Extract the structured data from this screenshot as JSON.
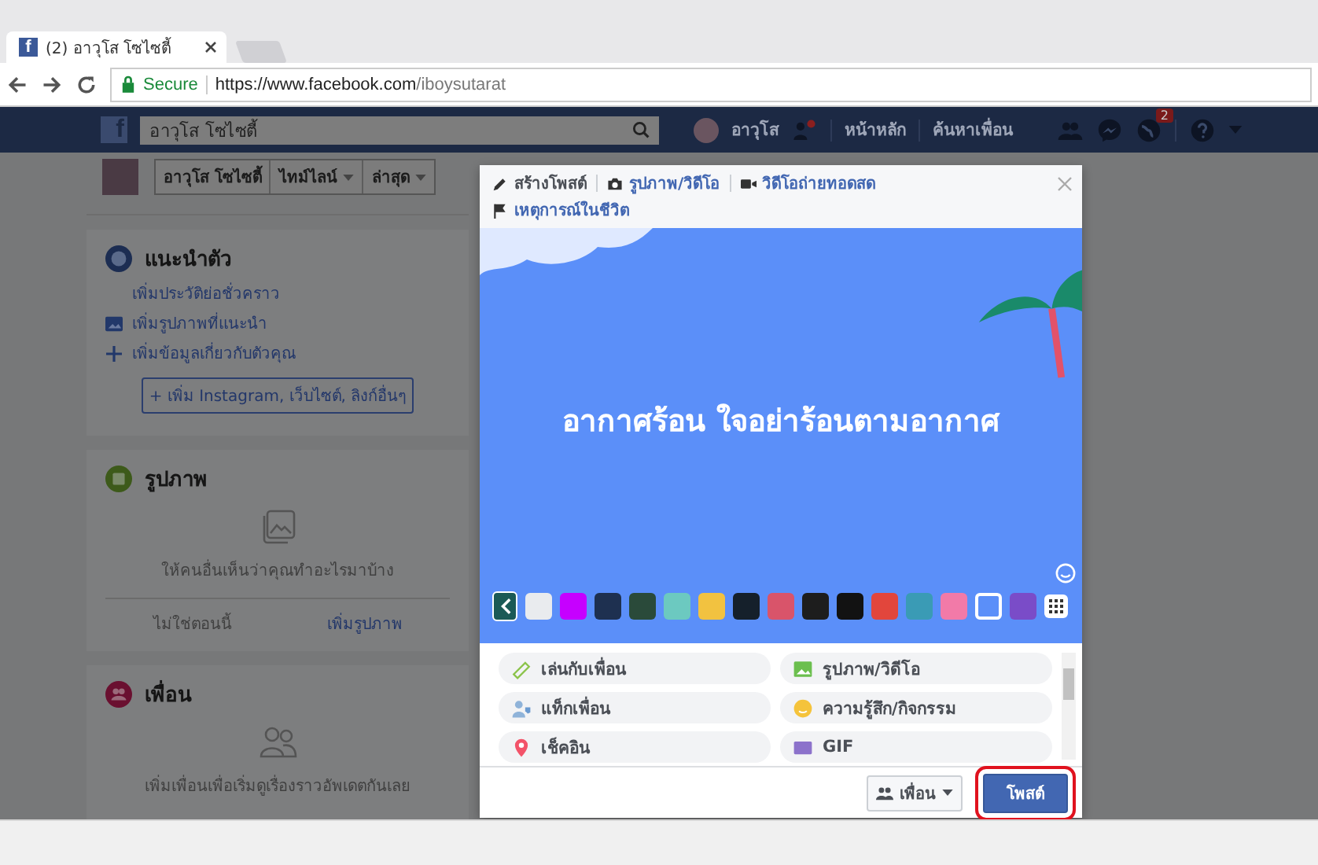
{
  "browser": {
    "favicon": "f",
    "tab_title": "(2) อาวุโส โซไซตี้",
    "secure_label": "Secure",
    "url_host": "https://www.facebook.com",
    "url_path": "/iboysutarat"
  },
  "header": {
    "logo": "f",
    "search_value": "อาวุโส โซไซตี้",
    "profile_name": "อาวุโส",
    "links": [
      "หน้าหลัก",
      "ค้นหาเพื่อน"
    ],
    "notification_count": "2"
  },
  "profile_bar": {
    "name": "อาวุโส โซไซตี้",
    "menus": [
      "ไทม์ไลน์",
      "ล่าสุด"
    ]
  },
  "intro": {
    "title": "แนะนำตัว",
    "links": [
      {
        "kind": "plain",
        "label": "เพิ่มประวัติย่อชั่วคราว"
      },
      {
        "kind": "photo",
        "label": "เพิ่มรูปภาพที่แนะนำ"
      },
      {
        "kind": "plus",
        "label": "เพิ่มข้อมูลเกี่ยวกับตัวคุณ"
      }
    ],
    "button": "+ เพิ่ม Instagram, เว็บไซต์, ลิงก์อื่นๆ"
  },
  "photos": {
    "title": "รูปภาพ",
    "text": "ให้คนอื่นเห็นว่าคุณทำอะไรมาบ้าง",
    "dismiss": "ไม่ใช่ตอนนี้",
    "action": "เพิ่มรูปภาพ"
  },
  "friends": {
    "title": "เพื่อน",
    "text": "เพิ่มเพื่อนเพื่อเริ่มดูเรื่องราวอัพเดตกันเลย"
  },
  "composer": {
    "tabs": [
      {
        "kind": "pencil",
        "label": "สร้างโพสต์",
        "selected": true
      },
      {
        "kind": "camera",
        "label": "รูปภาพ/วิดีโอ",
        "selected": false
      },
      {
        "kind": "video",
        "label": "วิดีโอถ่ายทอดสด",
        "selected": false
      },
      {
        "kind": "flag",
        "label": "เหตุการณ์ในชีวิต",
        "selected": false
      }
    ],
    "post_text": "อากาศร้อน ใจอย่าร้อนตามอากาศ",
    "backgrounds": [
      {
        "color": "#e9ebee",
        "selected": false
      },
      {
        "color": "#c600ff",
        "selected": false
      },
      {
        "color": "#1e3050",
        "selected": false
      },
      {
        "color": "#2a4a3a",
        "selected": false
      },
      {
        "color": "#6cc9c0",
        "selected": false
      },
      {
        "color": "#f2c240",
        "selected": false
      },
      {
        "color": "#15202b",
        "selected": false
      },
      {
        "color": "#d9546a",
        "selected": false
      },
      {
        "color": "#1d1d1d",
        "selected": false
      },
      {
        "color": "#121212",
        "selected": false
      },
      {
        "color": "#e2463c",
        "selected": false
      },
      {
        "color": "#3a9bb5",
        "selected": false
      },
      {
        "color": "#f27aa8",
        "selected": false
      },
      {
        "color": "#5b8ff9",
        "selected": true
      },
      {
        "color": "#7a4cc8",
        "selected": false
      }
    ],
    "options": [
      {
        "kind": "game",
        "label": "เล่นกับเพื่อน"
      },
      {
        "kind": "photo",
        "label": "รูปภาพ/วิดีโอ"
      },
      {
        "kind": "tag",
        "label": "แท็กเพื่อน"
      },
      {
        "kind": "feeling",
        "label": "ความรู้สึก/กิจกรรม"
      },
      {
        "kind": "checkin",
        "label": "เช็คอิน"
      },
      {
        "kind": "gif",
        "label": "GIF"
      }
    ],
    "audience": "เพื่อน",
    "post_button": "โพสต์",
    "post_highlighted": true
  }
}
